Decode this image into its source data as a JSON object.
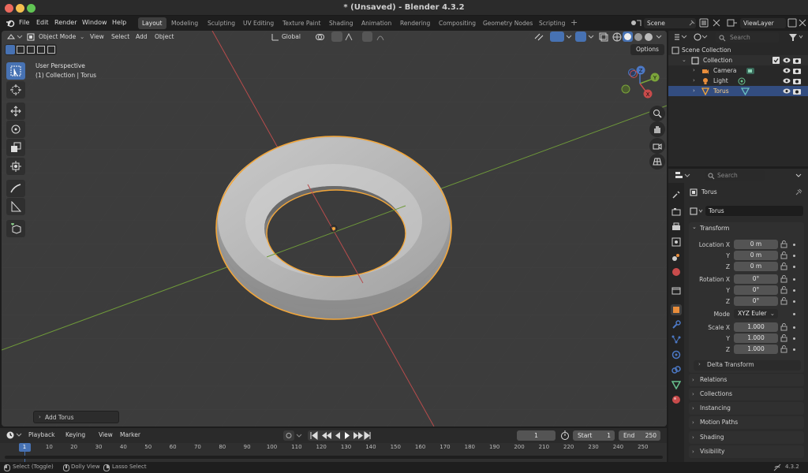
{
  "window": {
    "title": "* (Unsaved) - Blender 4.3.2"
  },
  "menu": [
    "File",
    "Edit",
    "Render",
    "Window",
    "Help"
  ],
  "workspaces": [
    "Layout",
    "Modeling",
    "Sculpting",
    "UV Editing",
    "Texture Paint",
    "Shading",
    "Animation",
    "Rendering",
    "Compositing",
    "Geometry Nodes",
    "Scripting"
  ],
  "active_workspace": "Layout",
  "scene": {
    "name": "Scene"
  },
  "view_layer": {
    "name": "ViewLayer"
  },
  "viewport": {
    "mode": "Object Mode",
    "menus": [
      "View",
      "Select",
      "Add",
      "Object"
    ],
    "orientation": "Global",
    "options_label": "Options",
    "overlay_line1": "User Perspective",
    "overlay_line2": "(1) Collection | Torus",
    "last_op": "Add Torus",
    "gizmo": {
      "x": "X",
      "y": "Y",
      "z": "Z"
    }
  },
  "outliner": {
    "search_placeholder": "Search",
    "scene_collection": "Scene Collection",
    "collection": "Collection",
    "items": [
      "Camera",
      "Light",
      "Torus"
    ]
  },
  "properties": {
    "search_placeholder": "Search",
    "object_name": "Torus",
    "data_name": "Torus",
    "transform_label": "Transform",
    "location_label": "Location X",
    "rotation_label": "Rotation X",
    "scale_label": "Scale X",
    "axis_y": "Y",
    "axis_z": "Z",
    "location": [
      "0 m",
      "0 m",
      "0 m"
    ],
    "rotation": [
      "0°",
      "0°",
      "0°"
    ],
    "mode_label": "Mode",
    "rotation_mode": "XYZ Euler",
    "scale": [
      "1.000",
      "1.000",
      "1.000"
    ],
    "delta_transform": "Delta Transform",
    "panels": [
      "Relations",
      "Collections",
      "Instancing",
      "Motion Paths",
      "Shading",
      "Visibility"
    ]
  },
  "timeline": {
    "menus": [
      "Playback",
      "Keying",
      "View",
      "Marker"
    ],
    "current_frame": "1",
    "start_label": "Start",
    "start": "1",
    "end_label": "End",
    "end": "250",
    "ticks": [
      "1",
      "10",
      "20",
      "30",
      "40",
      "50",
      "60",
      "70",
      "80",
      "90",
      "100",
      "110",
      "120",
      "130",
      "140",
      "150",
      "160",
      "170",
      "180",
      "190",
      "200",
      "210",
      "220",
      "230",
      "240",
      "250"
    ]
  },
  "statusbar": {
    "select_hint": "Select (Toggle)",
    "dolly_hint": "Dolly View",
    "lasso_hint": "Lasso Select",
    "version": "4.3.2"
  },
  "colors": {
    "accent": "#4772b3",
    "selection": "#f2a63a",
    "x_axis": "#c84b4b",
    "y_axis": "#7ba43a"
  }
}
